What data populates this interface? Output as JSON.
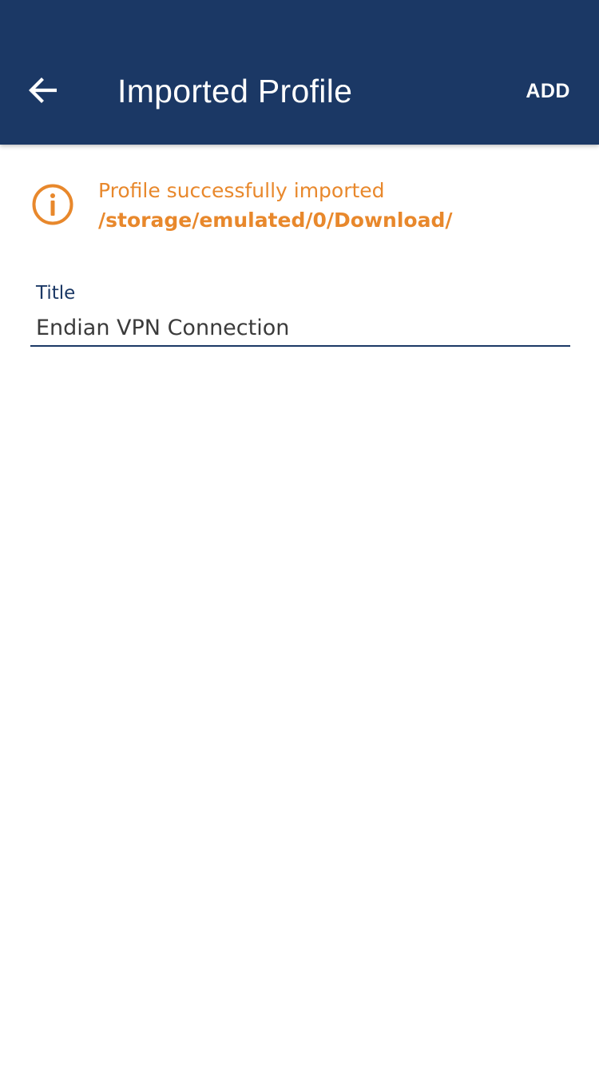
{
  "app_bar": {
    "title": "Imported Profile",
    "back_icon": "arrow-left-icon",
    "action_label": "ADD",
    "background_color": "#1b3865"
  },
  "notice": {
    "icon": "info-icon",
    "message": "Profile successfully imported",
    "path": "/storage/emulated/0/Download/",
    "color": "#e8882c"
  },
  "form": {
    "title_field": {
      "label": "Title",
      "value": "Endian VPN Connection"
    }
  }
}
